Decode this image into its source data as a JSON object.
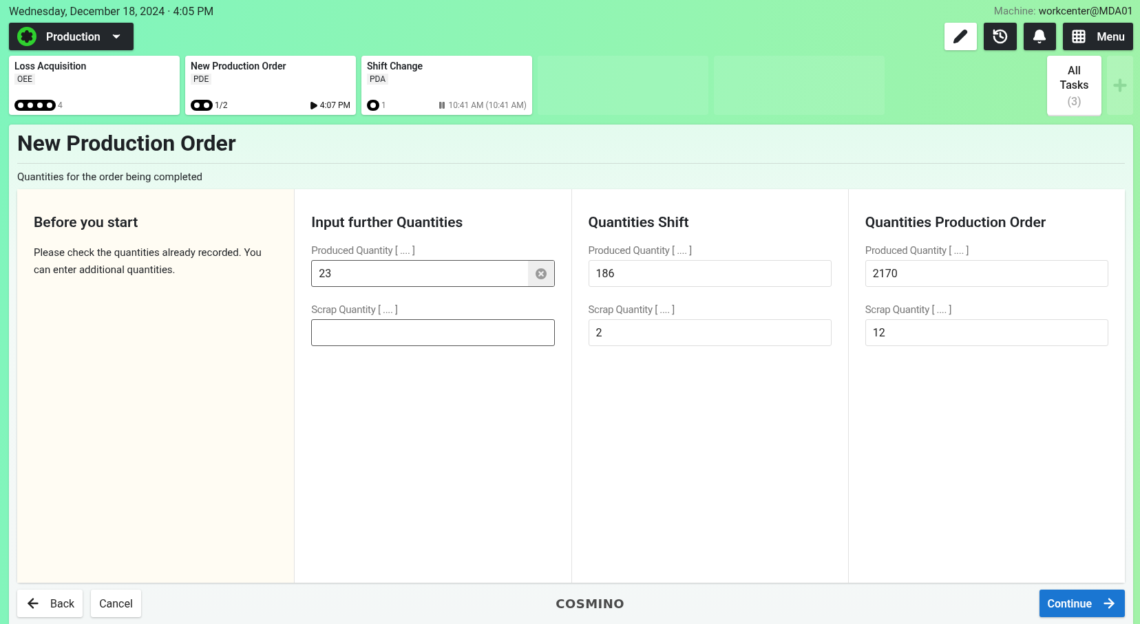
{
  "header": {
    "datetime": "Wednesday, December 18, 2024 · 4:05 PM",
    "machine_label": "Machine:",
    "machine": "workcenter@MDA01"
  },
  "mode_button": {
    "label": "Production"
  },
  "toolbar": [
    {
      "kind": "edit",
      "selected": true
    },
    {
      "kind": "history",
      "selected": false
    },
    {
      "kind": "notifications",
      "selected": false
    },
    {
      "kind": "menu",
      "label": "Menu",
      "selected": false
    }
  ],
  "tasks": [
    {
      "title": "Loss Acquisition",
      "tag": "OEE",
      "steps": [
        {
          "done": false
        },
        {
          "done": false
        },
        {
          "done": false
        },
        {
          "done": false
        }
      ],
      "count": "4",
      "kind": "idle"
    },
    {
      "title": "New Production Order",
      "tag": "PDE",
      "steps": [
        {
          "done": false
        },
        {
          "done": false
        }
      ],
      "count": "1/2",
      "kind": "running",
      "time": "4:07 PM"
    },
    {
      "title": "Shift Change",
      "tag": "PDA",
      "steps": [
        {
          "done": false
        }
      ],
      "count": "1",
      "kind": "paused",
      "time": "10:41 AM (10:41 AM)"
    }
  ],
  "all_tasks": {
    "label": "All Tasks",
    "count": "(3)"
  },
  "page": {
    "title": "New Production Order",
    "subtitle": "Quantities for the order being completed"
  },
  "info": {
    "title": "Before you start",
    "text": "Please check the quantities already recorded. You can enter additional quantities."
  },
  "columns": [
    {
      "title": "Input further Quantities",
      "fields": [
        {
          "label": "Produced Quantity [ .... ]",
          "value": "23",
          "editable": true,
          "clearable": true
        },
        {
          "label": "Scrap Quantity [ .... ]",
          "editable": true,
          "clearable": false
        }
      ]
    },
    {
      "title": "Quantities Shift",
      "fields": [
        {
          "label": "Produced Quantity [ .... ]",
          "value": "186",
          "editable": false,
          "clearable": false
        },
        {
          "label": "Scrap Quantity [ .... ]",
          "value": "2",
          "editable": false,
          "clearable": false
        }
      ]
    },
    {
      "title": "Quantities Production Order",
      "fields": [
        {
          "label": "Produced Quantity [ .... ]",
          "value": "2170",
          "editable": false,
          "clearable": false
        },
        {
          "label": "Scrap Quantity [ .... ]",
          "value": "12",
          "editable": false,
          "clearable": false
        }
      ]
    }
  ],
  "footer": {
    "back": "Back",
    "cancel": "Cancel",
    "logo": "COSMINO",
    "continue": "Continue"
  }
}
